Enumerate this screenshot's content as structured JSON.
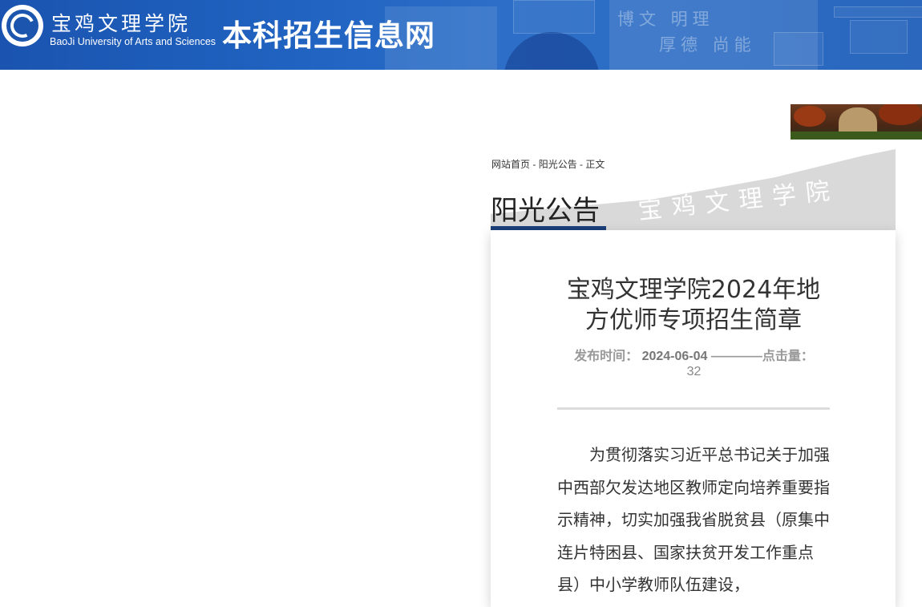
{
  "header": {
    "school_name_cn": "宝鸡文理学院",
    "school_name_en": "BaoJi University of Arts and Sciences",
    "site_title": "本科招生信息网",
    "motto_line1": "博文 明理",
    "motto_line2": "厚德 尚能",
    "logo_icon": "university-seal-icon"
  },
  "breadcrumb": {
    "home": "网站首页",
    "sep1": " - ",
    "section": "阳光公告",
    "sep2": " - ",
    "current": "正文"
  },
  "section": {
    "title": "阳光公告",
    "calligraphy": "宝鸡文理学院"
  },
  "article": {
    "title": "宝鸡文理学院2024年地方优师专项招生简章",
    "publish_label": "发布时间：",
    "publish_date": "2024-06-04",
    "separator": "————",
    "clicks_label": "点击量：",
    "clicks": "32",
    "body": "为贯彻落实习近平总书记关于加强中西部欠发达地区教师定向培养重要指示精神，切实加强我省脱贫县（原集中连片特困县、国家扶贫开发工作重点县）中小学教师队伍建设，"
  },
  "colors": {
    "header_blue": "#2164c2",
    "accent_navy": "#1b3f7a",
    "band_gray": "#d9d9d9"
  }
}
